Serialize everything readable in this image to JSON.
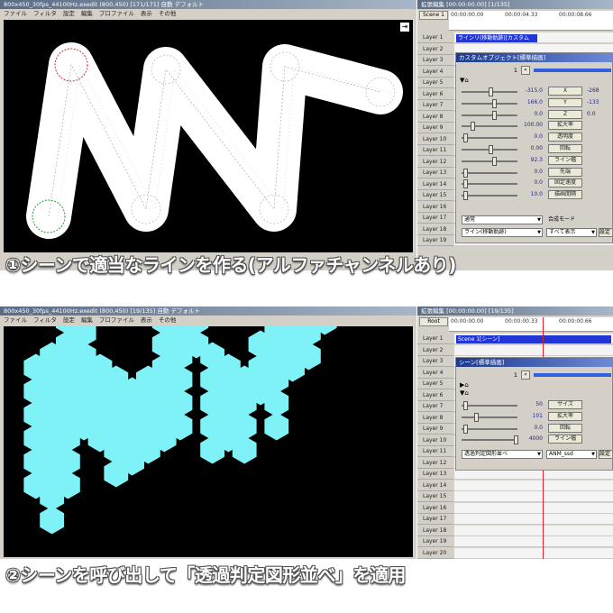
{
  "panel1": {
    "editor_title": "800x450_30fps_44100Hz.exedit (800,450)  [171/171]  自動  デフォルト",
    "menu": [
      "ファイル",
      "フィルタ",
      "設定",
      "編集",
      "プロファイル",
      "表示",
      "その他"
    ],
    "timeline_title": "拡張編集 [00:00:00.00] [1/135]",
    "scene_button": "Scene 1",
    "ruler": [
      "00:00:00.00",
      "00:00:04.33",
      "00:00:08.66"
    ],
    "layers": [
      "Layer 1",
      "Layer 2",
      "Layer 3",
      "Layer 4",
      "Layer 5",
      "Layer 6",
      "Layer 7",
      "Layer 8",
      "Layer 9",
      "Layer 10",
      "Layer 11",
      "Layer 12",
      "Layer 13",
      "Layer 14",
      "Layer 15",
      "Layer 16",
      "Layer 17",
      "Layer 18",
      "Layer 19"
    ],
    "clip_label": "ラインリ(移動軌跡)[カスタム",
    "object_title": "カスタムオブジェクト[標準描画]",
    "frame_number": "1",
    "params": [
      {
        "value": "-315.0",
        "button": "X",
        "value2": "-268"
      },
      {
        "value": "166.0",
        "button": "Y",
        "value2": "-133"
      },
      {
        "value": "0.0",
        "button": "Z",
        "value2": "0.0"
      },
      {
        "value": "100.00",
        "button": "拡大率",
        "value2": ""
      },
      {
        "value": "0.0",
        "button": "透明度",
        "value2": ""
      },
      {
        "value": "0.00",
        "button": "回転",
        "value2": ""
      },
      {
        "value": "92.3",
        "button": "ライン幅",
        "value2": ""
      },
      {
        "value": "0.0",
        "button": "先端",
        "value2": ""
      },
      {
        "value": "0.0",
        "button": "固定速度",
        "value2": ""
      },
      {
        "value": "10.0",
        "button": "描画間隔",
        "value2": ""
      }
    ],
    "blend_mode": "通常",
    "blend_label": "合成モード",
    "object_type": "ライン(移動軌跡)",
    "display_mode": "すべて表示",
    "settings_button": "設定",
    "caption": "①シーンで適当なラインを作る(アルファチャンネルあり)"
  },
  "panel2": {
    "editor_title": "800x450_30fps_44100Hz.exedit (800,450)  [19/135]  自動  デフォルト",
    "menu": [
      "ファイル",
      "フィルタ",
      "設定",
      "編集",
      "プロファイル",
      "表示",
      "その他"
    ],
    "timeline_title": "拡張編集 [00:00:00.00] [19/135]",
    "scene_button": "Root",
    "ruler": [
      "00:00:00.00",
      "00:00:00.33",
      "00:00:00.66"
    ],
    "layers": [
      "Layer 1",
      "Layer 2",
      "Layer 3",
      "Layer 4",
      "Layer 5",
      "Layer 6",
      "Layer 7",
      "Layer 8",
      "Layer 9",
      "Layer 10",
      "Layer 11",
      "Layer 12",
      "Layer 13",
      "Layer 14",
      "Layer 15",
      "Layer 16",
      "Layer 17",
      "Layer 18",
      "Layer 19",
      "Layer 20"
    ],
    "clip_label": "Scene 1[シーン]",
    "object_title": "シーン[標準描画]",
    "frame_number": "1",
    "params": [
      {
        "value": "50",
        "button": "サイズ"
      },
      {
        "value": "101",
        "button": "拡大率"
      },
      {
        "value": "0.0",
        "button": "回転"
      },
      {
        "value": "4000",
        "button": "ライン幅"
      }
    ],
    "effect_name": "透過判定図形並べ",
    "script_name": "ANM_ssd",
    "settings_button": "設定",
    "caption": "②シーンを呼び出して「透過判定図形並べ」を適用"
  },
  "colors": {
    "hex_fill": "#7ff2f8",
    "clip_blue": "#2236d6",
    "cursor": "#e0202a"
  }
}
